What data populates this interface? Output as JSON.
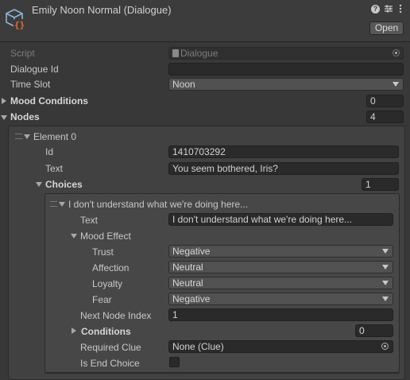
{
  "header": {
    "title": "Emily Noon Normal (Dialogue)",
    "open_label": "Open"
  },
  "fields": {
    "script": {
      "label": "Script",
      "value": "Dialogue"
    },
    "dialogue_id": {
      "label": "Dialogue Id",
      "value": ""
    },
    "time_slot": {
      "label": "Time Slot",
      "value": "Noon"
    },
    "mood_conditions": {
      "label": "Mood Conditions",
      "count": "0"
    },
    "nodes": {
      "label": "Nodes",
      "count": "4"
    }
  },
  "element0": {
    "label": "Element 0",
    "id_label": "Id",
    "id_value": "1410703292",
    "text_label": "Text",
    "text_value": "You seem bothered, Iris?",
    "choices_label": "Choices",
    "choices_count": "1"
  },
  "choice": {
    "header": "I don't understand what we're doing here...",
    "text_label": "Text",
    "text_value": "I don't understand what we're doing here...",
    "mood_effect_label": "Mood Effect",
    "trust_label": "Trust",
    "trust_value": "Negative",
    "affection_label": "Affection",
    "affection_value": "Neutral",
    "loyalty_label": "Loyalty",
    "loyalty_value": "Neutral",
    "fear_label": "Fear",
    "fear_value": "Negative",
    "next_node_label": "Next Node Index",
    "next_node_value": "1",
    "conditions_label": "Conditions",
    "conditions_count": "0",
    "required_clue_label": "Required Clue",
    "required_clue_value": "None (Clue)",
    "is_end_label": "Is End Choice"
  },
  "icons": [
    "scriptable-object-icon",
    "help-icon",
    "presets-icon",
    "kebab-menu-icon",
    "script-file-icon",
    "object-picker-icon"
  ]
}
